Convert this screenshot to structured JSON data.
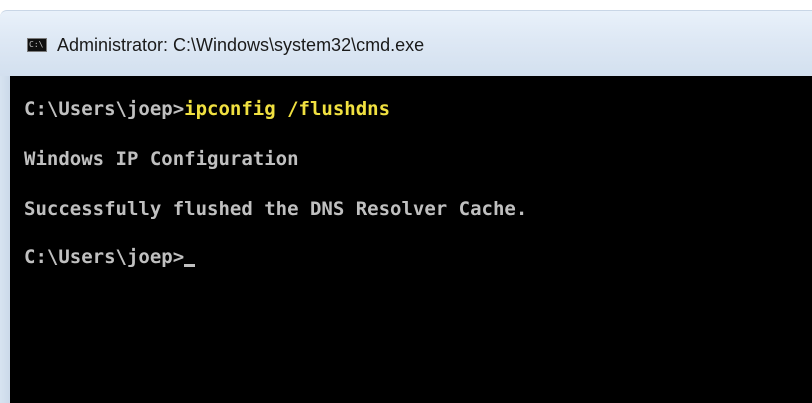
{
  "window": {
    "title": "Administrator: C:\\Windows\\system32\\cmd.exe",
    "icon": "cmd-icon",
    "icon_label": "C:\\"
  },
  "console": {
    "line1_prompt": "C:\\Users\\joep>",
    "line1_command": "ipconfig /flushdns",
    "line2": "Windows IP Configuration",
    "line3": "Successfully flushed the DNS Resolver Cache.",
    "line4_prompt": "C:\\Users\\joep>"
  },
  "colors": {
    "background": "#000000",
    "text": "#c0c0c0",
    "command": "#f0e040"
  }
}
